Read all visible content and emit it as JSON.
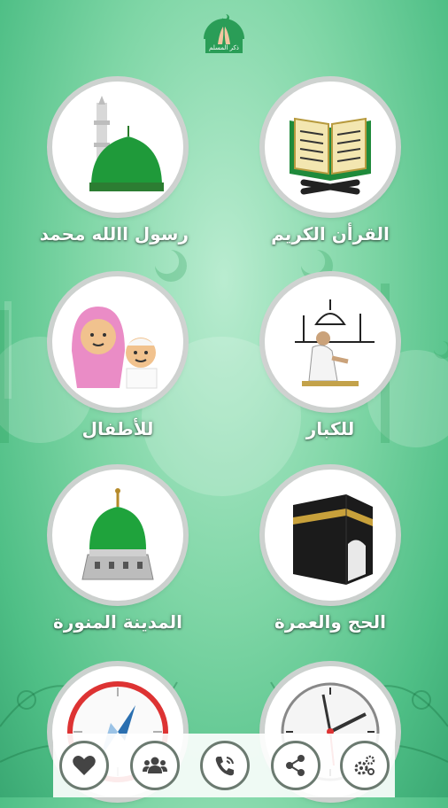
{
  "app": {
    "logo_text": "ذكر المسلم"
  },
  "tiles": [
    {
      "label": "القرأن الكريم",
      "icon": "quran-book-icon"
    },
    {
      "label": "رسول االله محمد",
      "icon": "mosque-dome-icon"
    },
    {
      "label": "للكبار",
      "icon": "man-praying-icon"
    },
    {
      "label": "للأطفال",
      "icon": "children-icon"
    },
    {
      "label": "الحج والعمرة",
      "icon": "kaaba-icon"
    },
    {
      "label": "المدينة المنورة",
      "icon": "green-dome-icon"
    },
    {
      "label": "",
      "icon": "clock-icon"
    },
    {
      "label": "",
      "icon": "compass-icon"
    }
  ],
  "bottom_nav": [
    {
      "icon": "settings-gears-icon"
    },
    {
      "icon": "share-icon"
    },
    {
      "icon": "phone-call-icon"
    },
    {
      "icon": "group-icon"
    },
    {
      "icon": "heart-icon"
    }
  ],
  "colors": {
    "background": "#7fd6a6",
    "label_text": "#ffffff",
    "dome_green": "#1f9a3a",
    "nav_border": "#6b7a70"
  }
}
